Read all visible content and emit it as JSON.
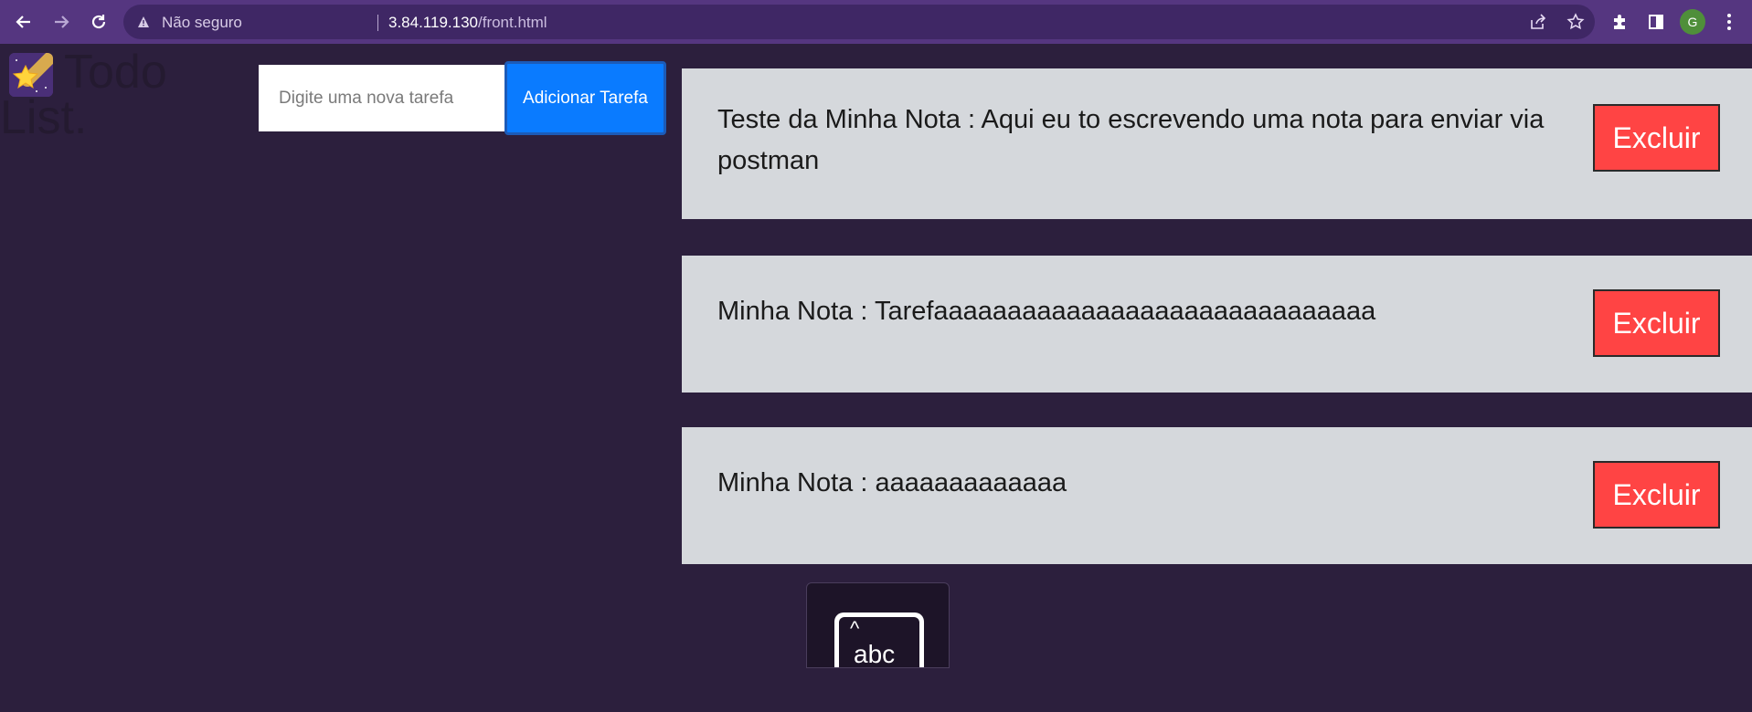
{
  "browser": {
    "security_label": "Não seguro",
    "url_host": "3.84.119.130",
    "url_path": "/front.html",
    "avatar_letter": "G",
    "theme_color": "#553680"
  },
  "app": {
    "logo_line1": "Todo",
    "logo_line2": "List.",
    "input_placeholder": "Digite uma nova tarefa",
    "add_button_label": "Adicionar Tarefa",
    "add_button_color": "#0a7bff",
    "delete_button_color": "#ff4444"
  },
  "tasks": [
    {
      "text": "Teste da Minha Nota : Aqui eu to escrevendo uma nota para enviar via postman",
      "delete_label": "Excluir"
    },
    {
      "text": "Minha Nota : Tarefaaaaaaaaaaaaaaaaaaaaaaaaaaaaaa",
      "delete_label": "Excluir"
    },
    {
      "text": "Minha Nota : aaaaaaaaaaaaa",
      "delete_label": "Excluir"
    }
  ],
  "keyboard_widget": {
    "label": "abc",
    "icon": "keyboard-icon"
  }
}
